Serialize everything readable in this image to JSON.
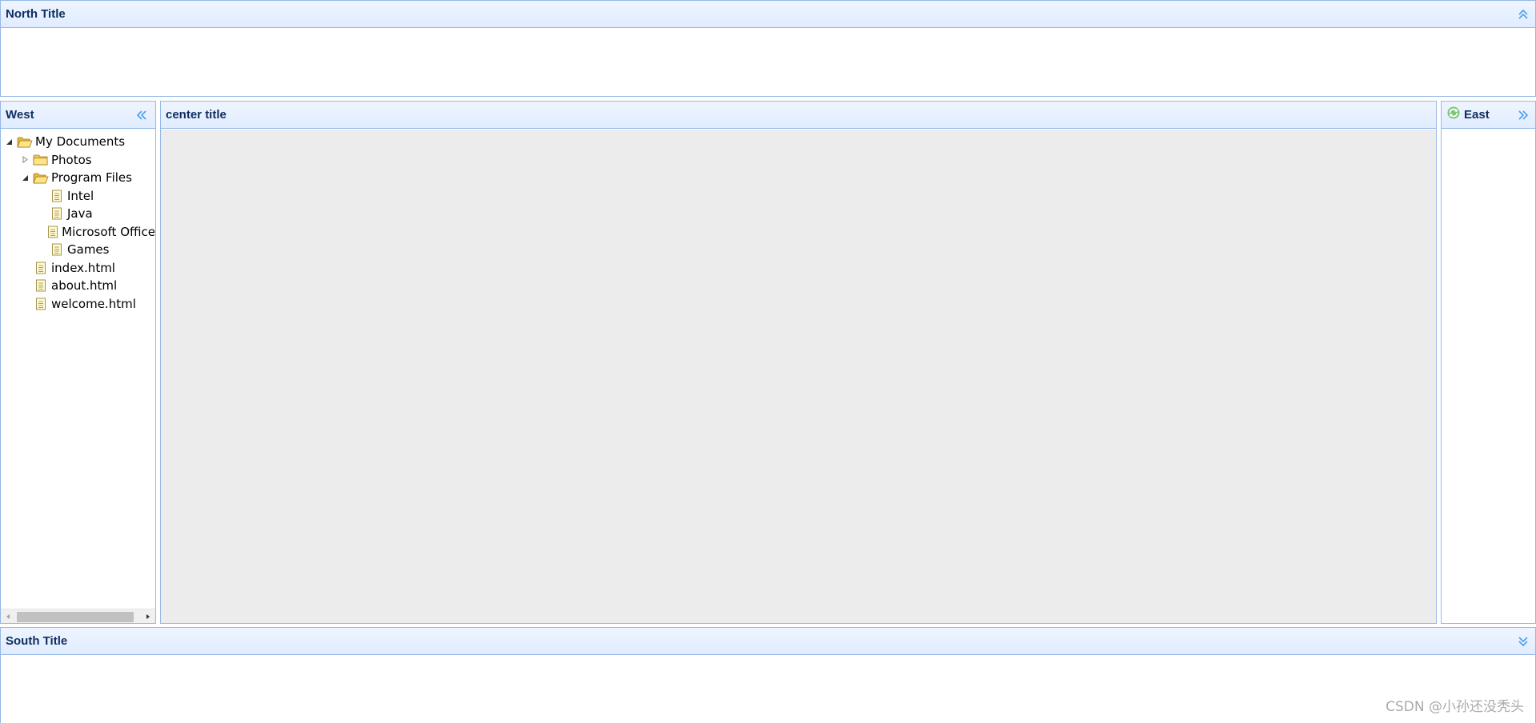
{
  "north": {
    "title": "North Title"
  },
  "west": {
    "title": "West",
    "tree": [
      {
        "label": "My Documents",
        "toggle": "expanded",
        "icon": "folder-open-icon",
        "level": 0
      },
      {
        "label": "Photos",
        "toggle": "collapsed",
        "icon": "folder-icon",
        "level": 1
      },
      {
        "label": "Program Files",
        "toggle": "expanded",
        "icon": "folder-open-icon",
        "level": 1
      },
      {
        "label": "Intel",
        "toggle": "none",
        "icon": "file-icon",
        "level": 2
      },
      {
        "label": "Java",
        "toggle": "none",
        "icon": "file-icon",
        "level": 2
      },
      {
        "label": "Microsoft Office",
        "toggle": "none",
        "icon": "file-icon",
        "level": 2
      },
      {
        "label": "Games",
        "toggle": "none",
        "icon": "file-icon",
        "level": 2
      },
      {
        "label": "index.html",
        "toggle": "none",
        "icon": "file-icon",
        "level": 1
      },
      {
        "label": "about.html",
        "toggle": "none",
        "icon": "file-icon",
        "level": 1
      },
      {
        "label": "welcome.html",
        "toggle": "none",
        "icon": "file-icon",
        "level": 1
      }
    ]
  },
  "center": {
    "title": "center title"
  },
  "east": {
    "title": "East"
  },
  "south": {
    "title": "South Title"
  },
  "watermark": "CSDN @小孙还没秃头",
  "colors": {
    "header_bg": "#e0ecff",
    "border": "#95b8e7",
    "title_text": "#0e2d5f",
    "tool_icon": "#4a9ee8",
    "center_bg": "#ececec"
  }
}
